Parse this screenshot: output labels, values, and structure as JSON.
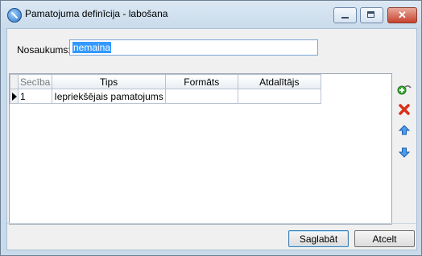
{
  "window": {
    "title": "Pamatojuma definīcija - labošana",
    "close_glyph": "✕"
  },
  "form": {
    "name_label": "Nosaukums:",
    "name_value": "nemaina"
  },
  "grid": {
    "columns": [
      "Secība",
      "Tips",
      "Formāts",
      "Atdalītājs"
    ],
    "rows": [
      {
        "seq": "1",
        "type": "Iepriekšējais pamatojums",
        "format": "",
        "separator": ""
      }
    ]
  },
  "toolbar": {
    "icons": [
      "add-icon",
      "delete-icon",
      "move-up-icon",
      "move-down-icon"
    ]
  },
  "buttons": {
    "save": "Saglabāt",
    "cancel": "Atcelt"
  }
}
